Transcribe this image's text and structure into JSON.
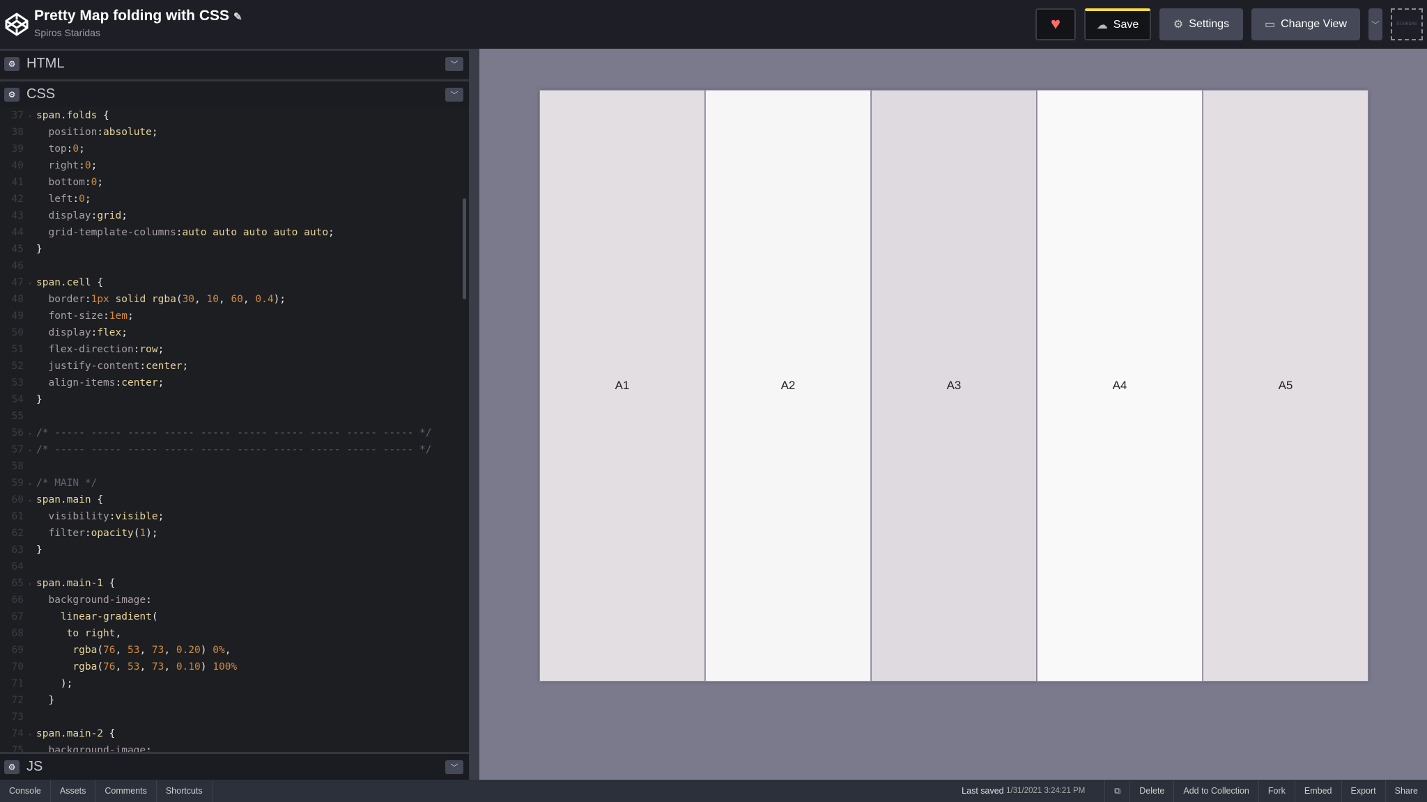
{
  "header": {
    "title": "Pretty Map folding with CSS",
    "author": "Spiros Staridas",
    "save": "Save",
    "settings": "Settings",
    "change_view": "Change View",
    "avatar_text": "STARIDAS",
    "heart_color": "#ff6b6b",
    "save_accent": "#ffdd40"
  },
  "panels": {
    "html": "HTML",
    "css": "CSS",
    "js": "JS"
  },
  "code": [
    {
      "n": "37",
      "f": true,
      "t": [
        [
          "s",
          "span.folds "
        ],
        [
          "x",
          "{"
        ]
      ]
    },
    {
      "n": "38",
      "t": [
        [
          "x",
          "  "
        ],
        [
          "p",
          "position"
        ],
        [
          "x",
          ":"
        ],
        [
          "v",
          "absolute"
        ],
        [
          "x",
          ";"
        ]
      ]
    },
    {
      "n": "39",
      "t": [
        [
          "x",
          "  "
        ],
        [
          "p",
          "top"
        ],
        [
          "x",
          ":"
        ],
        [
          "n",
          "0"
        ],
        [
          "x",
          ";"
        ]
      ]
    },
    {
      "n": "40",
      "t": [
        [
          "x",
          "  "
        ],
        [
          "p",
          "right"
        ],
        [
          "x",
          ":"
        ],
        [
          "n",
          "0"
        ],
        [
          "x",
          ";"
        ]
      ]
    },
    {
      "n": "41",
      "t": [
        [
          "x",
          "  "
        ],
        [
          "p",
          "bottom"
        ],
        [
          "x",
          ":"
        ],
        [
          "n",
          "0"
        ],
        [
          "x",
          ";"
        ]
      ]
    },
    {
      "n": "42",
      "t": [
        [
          "x",
          "  "
        ],
        [
          "p",
          "left"
        ],
        [
          "x",
          ":"
        ],
        [
          "n",
          "0"
        ],
        [
          "x",
          ";"
        ]
      ]
    },
    {
      "n": "43",
      "t": [
        [
          "x",
          "  "
        ],
        [
          "p",
          "display"
        ],
        [
          "x",
          ":"
        ],
        [
          "v",
          "grid"
        ],
        [
          "x",
          ";"
        ]
      ]
    },
    {
      "n": "44",
      "t": [
        [
          "x",
          "  "
        ],
        [
          "p",
          "grid-template-columns"
        ],
        [
          "x",
          ":"
        ],
        [
          "v",
          "auto auto auto auto auto"
        ],
        [
          "x",
          ";"
        ]
      ]
    },
    {
      "n": "45",
      "t": [
        [
          "x",
          "}"
        ]
      ]
    },
    {
      "n": "46",
      "t": []
    },
    {
      "n": "47",
      "f": true,
      "t": [
        [
          "s",
          "span.cell "
        ],
        [
          "x",
          "{"
        ]
      ]
    },
    {
      "n": "48",
      "t": [
        [
          "x",
          "  "
        ],
        [
          "p",
          "border"
        ],
        [
          "x",
          ":"
        ],
        [
          "n",
          "1px"
        ],
        [
          "v",
          " solid rgba"
        ],
        [
          "x",
          "("
        ],
        [
          "n",
          "30"
        ],
        [
          "x",
          ", "
        ],
        [
          "n",
          "10"
        ],
        [
          "x",
          ", "
        ],
        [
          "n",
          "60"
        ],
        [
          "x",
          ", "
        ],
        [
          "n",
          "0.4"
        ],
        [
          "x",
          ");"
        ]
      ]
    },
    {
      "n": "49",
      "t": [
        [
          "x",
          "  "
        ],
        [
          "p",
          "font-size"
        ],
        [
          "x",
          ":"
        ],
        [
          "n",
          "1em"
        ],
        [
          "x",
          ";"
        ]
      ]
    },
    {
      "n": "50",
      "t": [
        [
          "x",
          "  "
        ],
        [
          "p",
          "display"
        ],
        [
          "x",
          ":"
        ],
        [
          "v",
          "flex"
        ],
        [
          "x",
          ";"
        ]
      ]
    },
    {
      "n": "51",
      "t": [
        [
          "x",
          "  "
        ],
        [
          "p",
          "flex-direction"
        ],
        [
          "x",
          ":"
        ],
        [
          "v",
          "row"
        ],
        [
          "x",
          ";"
        ]
      ]
    },
    {
      "n": "52",
      "t": [
        [
          "x",
          "  "
        ],
        [
          "p",
          "justify-content"
        ],
        [
          "x",
          ":"
        ],
        [
          "v",
          "center"
        ],
        [
          "x",
          ";"
        ]
      ]
    },
    {
      "n": "53",
      "t": [
        [
          "x",
          "  "
        ],
        [
          "p",
          "align-items"
        ],
        [
          "x",
          ":"
        ],
        [
          "v",
          "center"
        ],
        [
          "x",
          ";"
        ]
      ]
    },
    {
      "n": "54",
      "t": [
        [
          "x",
          "}"
        ]
      ]
    },
    {
      "n": "55",
      "t": []
    },
    {
      "n": "56",
      "f": true,
      "t": [
        [
          "c",
          "/* ----- ----- ----- ----- ----- ----- ----- ----- ----- ----- */"
        ]
      ]
    },
    {
      "n": "57",
      "f": true,
      "t": [
        [
          "c",
          "/* ----- ----- ----- ----- ----- ----- ----- ----- ----- ----- */"
        ]
      ]
    },
    {
      "n": "58",
      "t": []
    },
    {
      "n": "59",
      "f": true,
      "t": [
        [
          "c",
          "/* MAIN */"
        ]
      ]
    },
    {
      "n": "60",
      "f": true,
      "t": [
        [
          "s",
          "span.main "
        ],
        [
          "x",
          "{"
        ]
      ]
    },
    {
      "n": "61",
      "t": [
        [
          "x",
          "  "
        ],
        [
          "p",
          "visibility"
        ],
        [
          "x",
          ":"
        ],
        [
          "v",
          "visible"
        ],
        [
          "x",
          ";"
        ]
      ]
    },
    {
      "n": "62",
      "t": [
        [
          "x",
          "  "
        ],
        [
          "p",
          "filter"
        ],
        [
          "x",
          ":"
        ],
        [
          "v",
          "opacity"
        ],
        [
          "x",
          "("
        ],
        [
          "n",
          "1"
        ],
        [
          "x",
          ");"
        ]
      ]
    },
    {
      "n": "63",
      "t": [
        [
          "x",
          "}"
        ]
      ]
    },
    {
      "n": "64",
      "t": []
    },
    {
      "n": "65",
      "f": true,
      "t": [
        [
          "s",
          "span.main-1 "
        ],
        [
          "x",
          "{"
        ]
      ]
    },
    {
      "n": "66",
      "t": [
        [
          "x",
          "  "
        ],
        [
          "p",
          "background-image"
        ],
        [
          "x",
          ":"
        ]
      ]
    },
    {
      "n": "67",
      "t": [
        [
          "x",
          "    "
        ],
        [
          "v",
          "linear-gradient"
        ],
        [
          "x",
          "("
        ]
      ]
    },
    {
      "n": "68",
      "t": [
        [
          "x",
          "     "
        ],
        [
          "v",
          "to right"
        ],
        [
          "x",
          ","
        ]
      ]
    },
    {
      "n": "69",
      "t": [
        [
          "x",
          "      "
        ],
        [
          "v",
          "rgba"
        ],
        [
          "x",
          "("
        ],
        [
          "n",
          "76"
        ],
        [
          "x",
          ", "
        ],
        [
          "n",
          "53"
        ],
        [
          "x",
          ", "
        ],
        [
          "n",
          "73"
        ],
        [
          "x",
          ", "
        ],
        [
          "n",
          "0.20"
        ],
        [
          "x",
          ") "
        ],
        [
          "n",
          "0%"
        ],
        [
          "x",
          ","
        ]
      ]
    },
    {
      "n": "70",
      "t": [
        [
          "x",
          "      "
        ],
        [
          "v",
          "rgba"
        ],
        [
          "x",
          "("
        ],
        [
          "n",
          "76"
        ],
        [
          "x",
          ", "
        ],
        [
          "n",
          "53"
        ],
        [
          "x",
          ", "
        ],
        [
          "n",
          "73"
        ],
        [
          "x",
          ", "
        ],
        [
          "n",
          "0.10"
        ],
        [
          "x",
          ") "
        ],
        [
          "n",
          "100%"
        ]
      ]
    },
    {
      "n": "71",
      "t": [
        [
          "x",
          "    );"
        ]
      ]
    },
    {
      "n": "72",
      "t": [
        [
          "x",
          "  }"
        ]
      ]
    },
    {
      "n": "73",
      "t": []
    },
    {
      "n": "74",
      "f": true,
      "t": [
        [
          "s",
          "span.main-2 "
        ],
        [
          "x",
          "{"
        ]
      ]
    },
    {
      "n": "75",
      "t": [
        [
          "x",
          "  "
        ],
        [
          "p",
          "background-image"
        ],
        [
          "x",
          ":"
        ]
      ]
    }
  ],
  "preview": {
    "cells": [
      {
        "label": "A1",
        "bg": "#e2dee2"
      },
      {
        "label": "A2",
        "bg": "#f7f6f7"
      },
      {
        "label": "A3",
        "bg": "#dfdadf"
      },
      {
        "label": "A4",
        "bg": "#f9f9f9"
      },
      {
        "label": "A5",
        "bg": "#e2dee2"
      }
    ]
  },
  "footer": {
    "left": [
      "Console",
      "Assets",
      "Comments",
      "Shortcuts"
    ],
    "last_saved_label": "Last saved",
    "last_saved_time": "1/31/2021 3:24:21 PM",
    "right": [
      "Delete",
      "Add to Collection",
      "Fork",
      "Embed",
      "Export",
      "Share"
    ]
  }
}
